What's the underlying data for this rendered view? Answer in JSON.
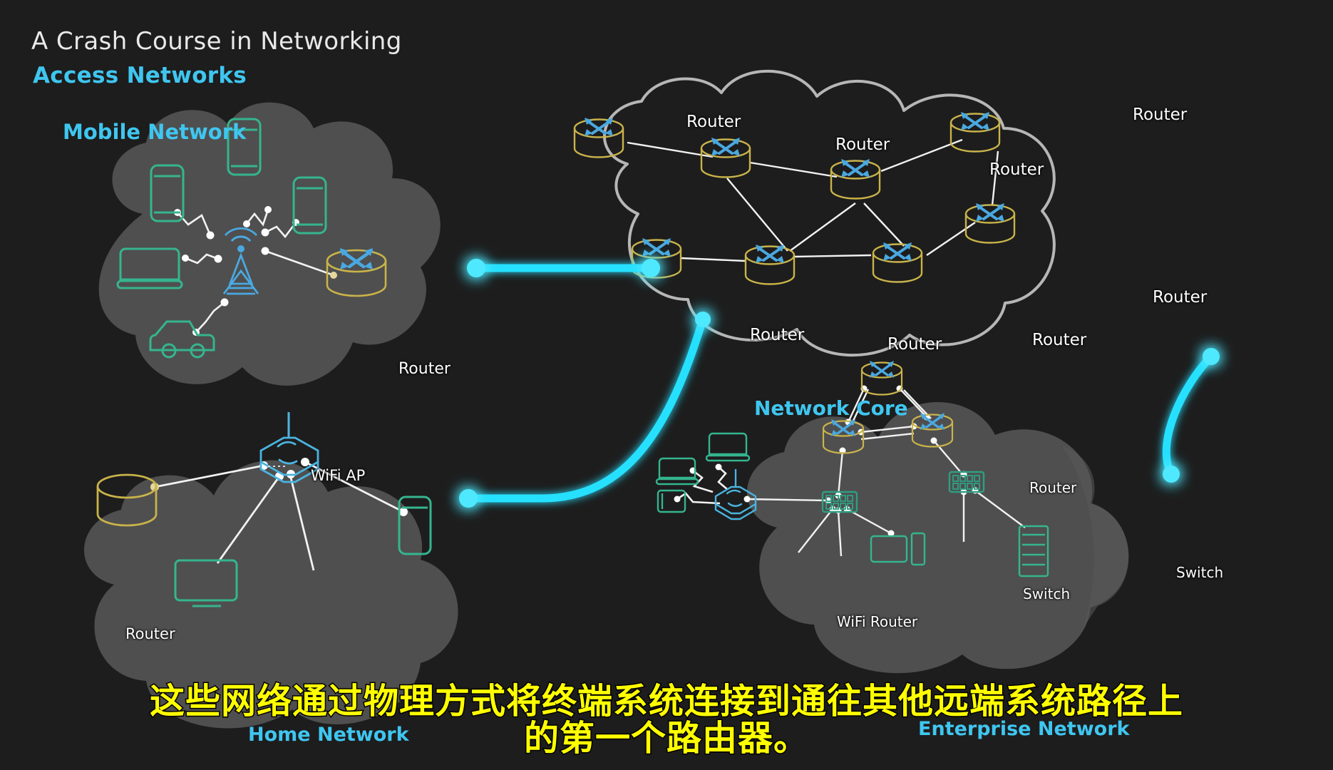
{
  "title": {
    "main": "A Crash Course in Networking",
    "sub": "Access Networks"
  },
  "colors": {
    "background": "#1d1d1d",
    "cloud_fill": "#4f4f4f",
    "core_outline": "#b6b6b6",
    "accent_cyan": "#3fc6f0",
    "link_cyan": "#25e0ff",
    "router_gold": "#c9b34a",
    "device_green": "#35b58e",
    "switch_green": "#2f9e82",
    "wifi_blue": "#4ab4e0",
    "arrow_blue": "#4aa8e0",
    "link_white": "#f2f2f2",
    "subtitle_yellow": "#ffff00",
    "subtitle_stroke": "#000000",
    "title_white": "#e9e9e9"
  },
  "zones": [
    {
      "id": "mobile",
      "label": "Mobile Network"
    },
    {
      "id": "core",
      "label": "Network Core"
    },
    {
      "id": "home",
      "label": "Home Network"
    },
    {
      "id": "enterprise",
      "label": "Enterprise Network"
    }
  ],
  "mobile_network": {
    "label": "Mobile Network",
    "router_label": "Router",
    "devices": [
      {
        "type": "phone-icon",
        "name": "phone-upper-left"
      },
      {
        "type": "phone-icon",
        "name": "phone-top"
      },
      {
        "type": "phone-icon",
        "name": "phone-right"
      },
      {
        "type": "laptop-icon",
        "name": "laptop"
      },
      {
        "type": "car-icon",
        "name": "connected-car"
      },
      {
        "type": "cell-tower-icon",
        "name": "cell-tower"
      },
      {
        "type": "router-icon",
        "name": "mobile-router"
      }
    ]
  },
  "network_core": {
    "label": "Network Core",
    "routers": [
      {
        "id": "r1",
        "label": "Router",
        "label_pos": "top"
      },
      {
        "id": "r2",
        "label": "Router",
        "label_pos": "top"
      },
      {
        "id": "r3",
        "label": "Router",
        "label_pos": "top"
      },
      {
        "id": "r4",
        "label": "Router",
        "label_pos": "top"
      },
      {
        "id": "r5",
        "label": "Router",
        "label_pos": "bottom"
      },
      {
        "id": "r6",
        "label": "Router",
        "label_pos": "bottom"
      },
      {
        "id": "r7",
        "label": "Router",
        "label_pos": "bottom"
      },
      {
        "id": "r8",
        "label": "Router",
        "label_pos": "bottom"
      }
    ],
    "router_count": 8
  },
  "home_network": {
    "label": "Home Network",
    "router_label": "Router",
    "wifi_ap_label": "WiFi AP",
    "devices": [
      {
        "type": "router-plain-icon",
        "name": "home-router"
      },
      {
        "type": "wifi-ap-icon",
        "name": "home-wifi-ap"
      },
      {
        "type": "phone-icon",
        "name": "home-phone"
      },
      {
        "type": "tv-icon",
        "name": "home-tv"
      }
    ]
  },
  "enterprise_network": {
    "label": "Enterprise Network",
    "router_label": "Router",
    "switch_label": "Switch",
    "wifi_router_label": "WiFi Router",
    "devices": [
      {
        "type": "router-icon",
        "name": "enterprise-router-top"
      },
      {
        "type": "router-icon",
        "name": "enterprise-router-left"
      },
      {
        "type": "router-icon",
        "name": "enterprise-router-right"
      },
      {
        "type": "switch-icon",
        "name": "enterprise-switch-center"
      },
      {
        "type": "switch-icon",
        "name": "enterprise-switch-right"
      },
      {
        "type": "wifi-router-icon",
        "name": "enterprise-wifi-router"
      },
      {
        "type": "laptop-icon",
        "name": "enterprise-laptop-a"
      },
      {
        "type": "laptop-icon",
        "name": "enterprise-laptop-b"
      },
      {
        "type": "desktop-icon",
        "name": "enterprise-desktop"
      },
      {
        "type": "server-rack-icon",
        "name": "enterprise-server-rack"
      },
      {
        "type": "printer-icon",
        "name": "enterprise-printer"
      }
    ],
    "labels": [
      {
        "text": "Router",
        "name": "enterprise-router-label"
      },
      {
        "text": "Switch",
        "name": "enterprise-switch-center-label"
      },
      {
        "text": "Switch",
        "name": "enterprise-switch-right-label"
      },
      {
        "text": "WiFi Router",
        "name": "enterprise-wifi-router-label"
      }
    ]
  },
  "backbone_links": [
    {
      "from": "mobile-network",
      "to": "network-core",
      "style": "cyan-glow"
    },
    {
      "from": "home-network",
      "to": "network-core",
      "style": "cyan-glow-curve"
    },
    {
      "from": "enterprise-network",
      "to": "network-core",
      "style": "cyan-glow-curve"
    }
  ],
  "subtitle": {
    "line1": "这些网络通过物理方式将终端系统连接到通往其他远端系统路径上",
    "line2": "的第一个路由器。"
  }
}
